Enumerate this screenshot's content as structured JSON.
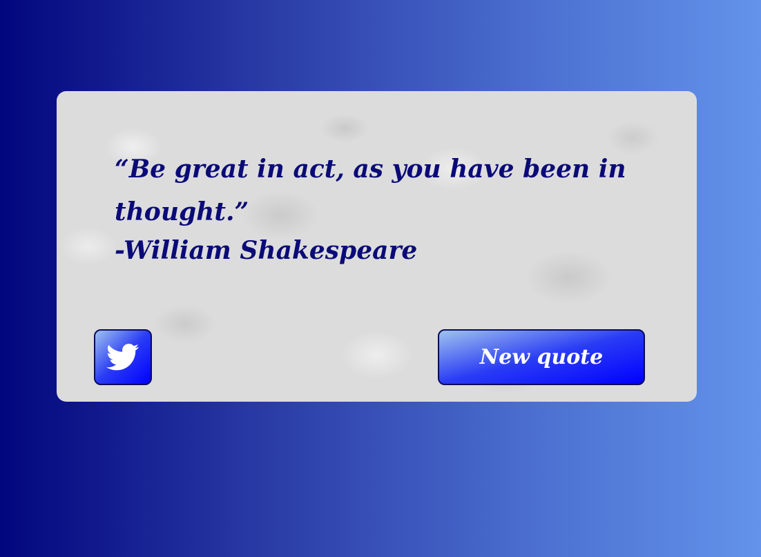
{
  "quote": {
    "text": "“Be great in act, as you have been in thought.”",
    "author": "-William Shakespeare"
  },
  "buttons": {
    "tweet_icon": "twitter-icon",
    "new_quote_label": "New quote"
  },
  "colors": {
    "quote_text": "#0a0a78",
    "button_start": "#0000ff",
    "button_end": "#9fc3ee",
    "background_left": "#02067e",
    "background_right": "#6393ea"
  }
}
